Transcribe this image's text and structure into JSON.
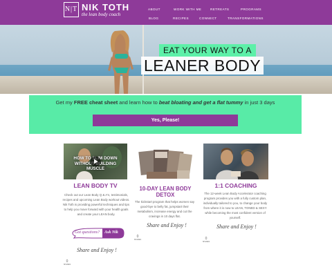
{
  "logo": {
    "mark": "N|T",
    "name": "NIK TOTH",
    "tagline": "the lean body coach"
  },
  "nav": [
    {
      "label": "ABOUT"
    },
    {
      "label": "WORK WITH ME"
    },
    {
      "label": "RETREATS"
    },
    {
      "label": "PROGRAMS"
    },
    {
      "label": "BLOG"
    },
    {
      "label": "RECIPES"
    },
    {
      "label": "CONNECT"
    },
    {
      "label": "TRANSFORMATIONS"
    }
  ],
  "hero": {
    "line1": "EAT YOUR WAY TO A",
    "line2": "LEANER BODY"
  },
  "cta": {
    "text_before": "Get my ",
    "text_bold": "FREE cheat sheet",
    "text_mid": " and learn how to ",
    "text_emph": "beat bloating and get a flat tummy",
    "text_after": " in just 3 days",
    "button": "Yes, Please!"
  },
  "cards": [
    {
      "video_caption": "HOW TO SLIM DOWN WITHOUT BUILDING MUSCLE",
      "title": "LEAN BODY TV",
      "body": "Check out our Lean Body Q & A's, testimonials, recipes and upcoming Lean Body workout videos. Nik Toth is providing powerful techniques and tips to help you move forward with your health goals and create your LEAN body.",
      "bubble_left": "Got questions?",
      "bubble_right": "Ask Nik",
      "enjoy": "Share and Enjoy !",
      "share_count": "0",
      "share_label": "SHARES"
    },
    {
      "title_line1": "10-DAY LEAN BODY",
      "title_line2": "DETOX",
      "body": "The kickstart program that helps women say good-bye to belly fat, jumpstart their metabolism, increase energy and cut the cravings in 10 days flat.",
      "enjoy": "Share and Enjoy !",
      "share_count": "0",
      "share_label": "SHARES"
    },
    {
      "title": "1:1 COACHING",
      "body": "The 12-week Lean Body Accelerator coaching program provides you with a fully custom plan, individually tailored to you, to change your body from where it is now to LEAN, TONED & SEXY while becoming the most confident version of yourself.",
      "enjoy": "Share and Enjoy !",
      "share_count": "0",
      "share_label": "SHARES"
    }
  ],
  "colors": {
    "brand": "#8e3a99",
    "accent": "#58eba7"
  }
}
